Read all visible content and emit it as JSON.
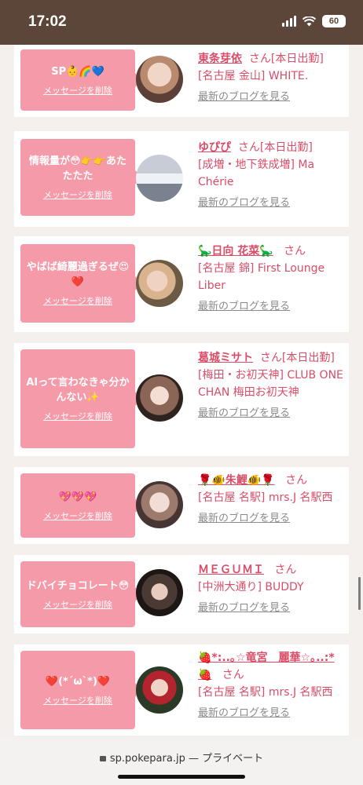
{
  "status": {
    "time": "17:02",
    "battery": "60"
  },
  "cards": [
    {
      "message": "SP👶🌈💙",
      "delete_label": "メッセージを削除",
      "name": "東条芽依",
      "san": "さん",
      "status": "[本日出勤]",
      "shop": "[名古屋 金山] WHITE.",
      "blog_label": "最新のブログを見る"
    },
    {
      "message": "情報量が😳👉👉あたたたた",
      "delete_label": "メッセージを削除",
      "name": "ゆぴぴ",
      "san": "さん",
      "status": "[本日出勤]",
      "shop": "[成増・地下鉄成増] Ma Chérie",
      "blog_label": "最新のブログを見る"
    },
    {
      "message": "やばば綺麗過ぎるぜ😍❤️",
      "delete_label": "メッセージを削除",
      "name": "🦕日向 花菜🦕",
      "san": "さん",
      "status": "",
      "shop": "[名古屋 錦] First Lounge Liber",
      "blog_label": "最新のブログを見る"
    },
    {
      "message": "AIって言わなきゃ分かんない✨",
      "delete_label": "メッセージを削除",
      "name": "葛城ミサト",
      "san": "さん",
      "status": "[本日出勤]",
      "shop": "[梅田・お初天神] CLUB ONE CHAN 梅田お初天神",
      "blog_label": "最新のブログを見る"
    },
    {
      "message": "💖💖💖",
      "delete_label": "メッセージを削除",
      "name": "🌹🐠朱鯉🐠🌹",
      "san": "さん",
      "status": "",
      "shop": "[名古屋 名駅] mrs.J 名駅西",
      "blog_label": "最新のブログを見る"
    },
    {
      "message": "ドバイチョコレート😳",
      "delete_label": "メッセージを削除",
      "name": "ＭＥＧＵＭＩ",
      "san": "さん",
      "status": "",
      "shop": "[中洲大通り] BUDDY",
      "blog_label": "最新のブログを見る"
    },
    {
      "message": "❤️(*´ω`*)❤️",
      "delete_label": "メッセージを削除",
      "name": "🍓*:..｡☆竜宮　麗華☆｡..:*🍓",
      "san": "さん",
      "status": "",
      "shop": "[名古屋 名駅] mrs.J 名駅西",
      "blog_label": "最新のブログを見る"
    }
  ],
  "browser": {
    "url": "sp.pokepara.jp",
    "separator": "—",
    "mode": "プライベート"
  }
}
